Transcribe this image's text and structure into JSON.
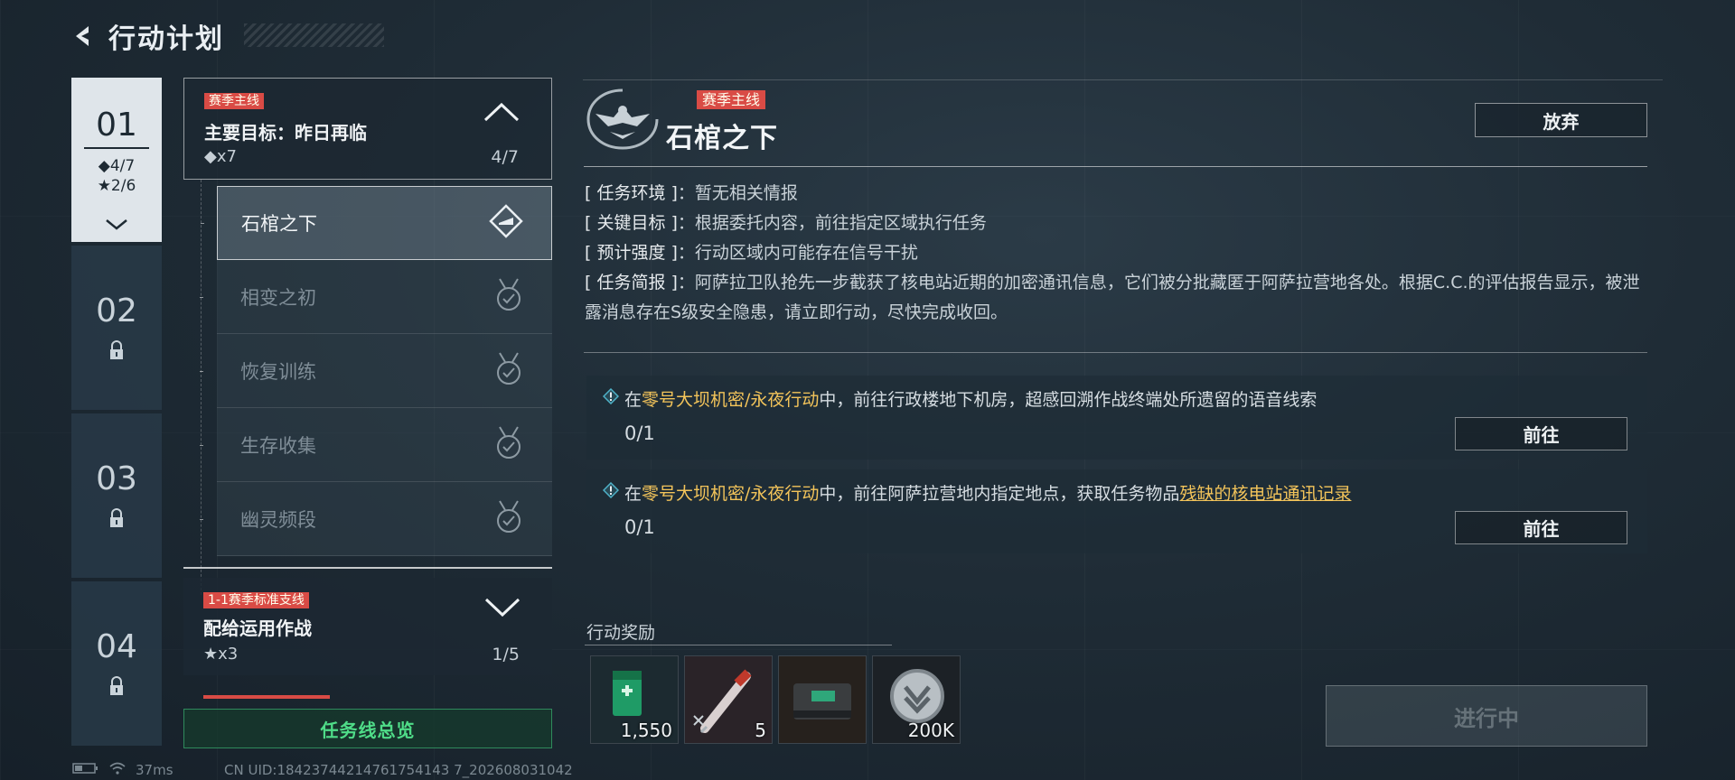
{
  "header": {
    "title": "行动计划"
  },
  "chapters": [
    {
      "num": "01",
      "stat1": "◆4/7",
      "stat2": "★2/6",
      "active": true
    },
    {
      "num": "02",
      "locked": true
    },
    {
      "num": "03",
      "locked": true
    },
    {
      "num": "04",
      "locked": true
    }
  ],
  "main_mission": {
    "tag": "赛季主线",
    "title": "主要目标：昨日再临",
    "count": "◆x7",
    "progress": "4/7"
  },
  "sub_missions": [
    {
      "label": "石棺之下",
      "status": "active"
    },
    {
      "label": "相变之初",
      "status": "completed"
    },
    {
      "label": "恢复训练",
      "status": "completed"
    },
    {
      "label": "生存收集",
      "status": "completed"
    },
    {
      "label": "幽灵频段",
      "status": "completed"
    }
  ],
  "branch_mission": {
    "tag": "1-1赛季标准支线",
    "title": "配给运用作战",
    "count": "★x3",
    "progress": "1/5"
  },
  "overview_button": "任务线总览",
  "detail": {
    "tag": "赛季主线",
    "title": "石棺之下",
    "abandon": "放弃",
    "info": [
      {
        "key": "[ 任务环境 ]",
        "value": "：暂无相关情报"
      },
      {
        "key": "[ 关键目标 ]",
        "value": "：根据委托内容，前往指定区域执行任务"
      },
      {
        "key": "[ 预计强度 ]",
        "value": "：行动区域内可能存在信号干扰"
      },
      {
        "key": "[ 任务简报 ]",
        "value": "：阿萨拉卫队抢先一步截获了核电站近期的加密通讯信息，它们被分批藏匿于阿萨拉营地各处。根据C.C.的评估报告显示，被泄露消息存在S级安全隐患，请立即行动，尽快完成收回。"
      }
    ],
    "tasks": [
      {
        "prefix": "在",
        "location": "零号大坝机密/永夜行动",
        "text": "中，前往行政楼地下机房，超感回溯作战终端处所遗留的语音线索",
        "item": "",
        "progress": "0/1",
        "button": "前往"
      },
      {
        "prefix": "在",
        "location": "零号大坝机密/永夜行动",
        "text": "中，前往阿萨拉营地内指定地点，获取任务物品",
        "item": "残缺的核电站通讯记录",
        "progress": "0/1",
        "button": "前往"
      }
    ],
    "reward_label": "行动奖励",
    "rewards": [
      {
        "icon": "green-medkit-icon",
        "qty": "1,550"
      },
      {
        "icon": "syringe-icon",
        "qty": "5"
      },
      {
        "icon": "ammo-case-icon",
        "qty": ""
      },
      {
        "icon": "silver-coin-icon",
        "qty": "200K"
      }
    ],
    "status_button": "进行中"
  },
  "statusbar": {
    "ping": "37ms",
    "uid": "CN UID:18423744214761754143 7_202608031042"
  },
  "colors": {
    "accent_red": "#d94b45",
    "accent_green": "#4fdc88",
    "highlight_yellow": "#f3c45a"
  }
}
